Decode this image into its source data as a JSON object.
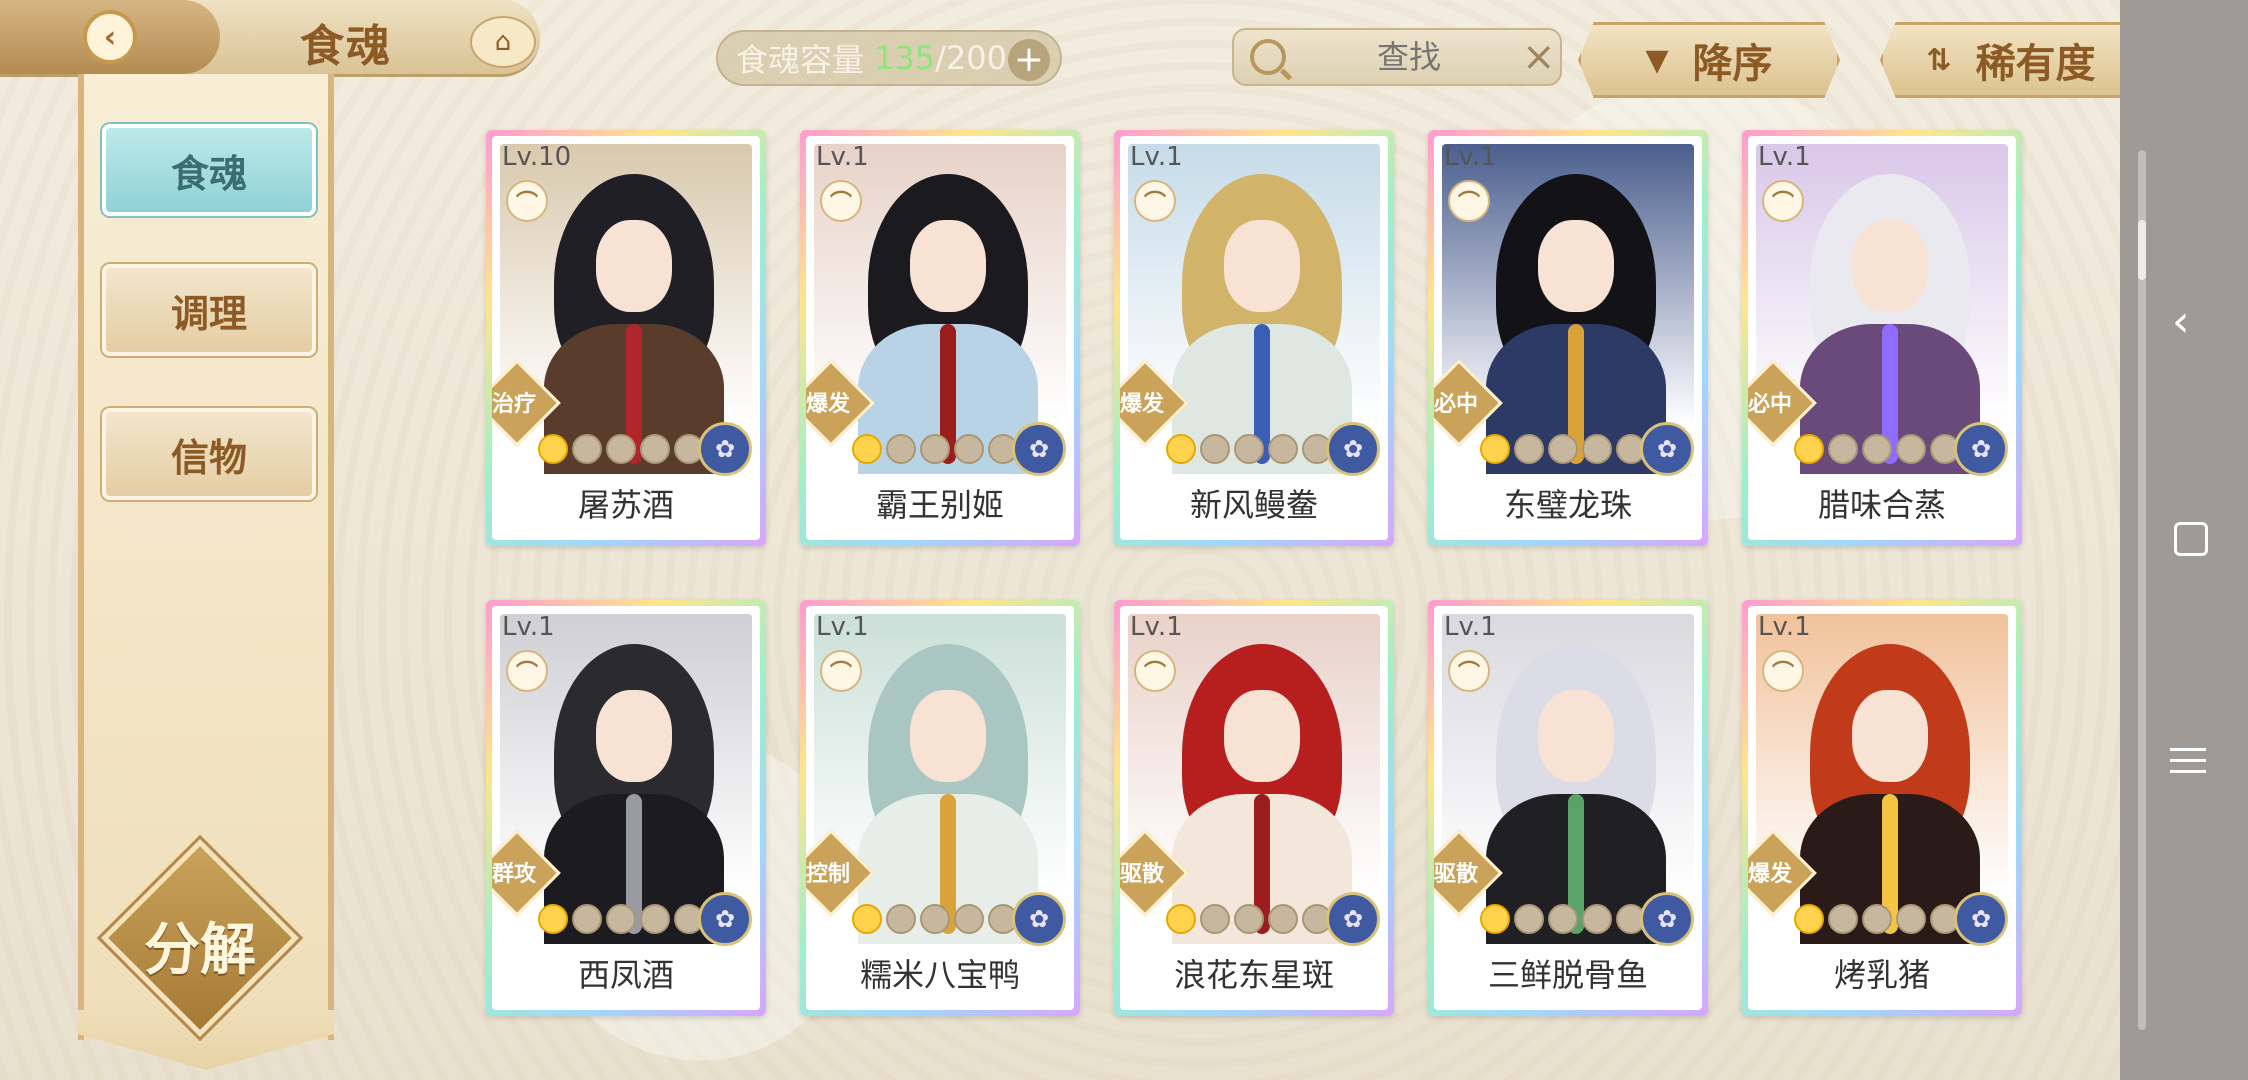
{
  "header": {
    "title": "食魂",
    "capacity_label": "食魂容量",
    "capacity_current": "135",
    "capacity_total": "/200",
    "search_placeholder": "查找",
    "sort_order_label": "降序",
    "sort_rarity_label": "稀有度"
  },
  "nav": {
    "items": [
      {
        "label": "食魂",
        "active": true
      },
      {
        "label": "调理",
        "active": false
      },
      {
        "label": "信物",
        "active": false
      }
    ],
    "decompose_label": "分解"
  },
  "cards": [
    {
      "level": "Lv.10",
      "role": "治疗",
      "name": "屠苏酒",
      "stars_on": 1
    },
    {
      "level": "Lv.1",
      "role": "爆发",
      "name": "霸王别姬",
      "stars_on": 1
    },
    {
      "level": "Lv.1",
      "role": "爆发",
      "name": "新风鳗鲞",
      "stars_on": 1
    },
    {
      "level": "Lv.1",
      "role": "必中",
      "name": "东璧龙珠",
      "stars_on": 1
    },
    {
      "level": "Lv.1",
      "role": "必中",
      "name": "腊味合蒸",
      "stars_on": 1
    },
    {
      "level": "Lv.1",
      "role": "群攻",
      "name": "西凤酒",
      "stars_on": 1
    },
    {
      "level": "Lv.1",
      "role": "控制",
      "name": "糯米八宝鸭",
      "stars_on": 1
    },
    {
      "level": "Lv.1",
      "role": "驱散",
      "name": "浪花东星斑",
      "stars_on": 1
    },
    {
      "level": "Lv.1",
      "role": "驱散",
      "name": "三鲜脱骨鱼",
      "stars_on": 1
    },
    {
      "level": "Lv.1",
      "role": "爆发",
      "name": "烤乳猪",
      "stars_on": 1
    }
  ]
}
